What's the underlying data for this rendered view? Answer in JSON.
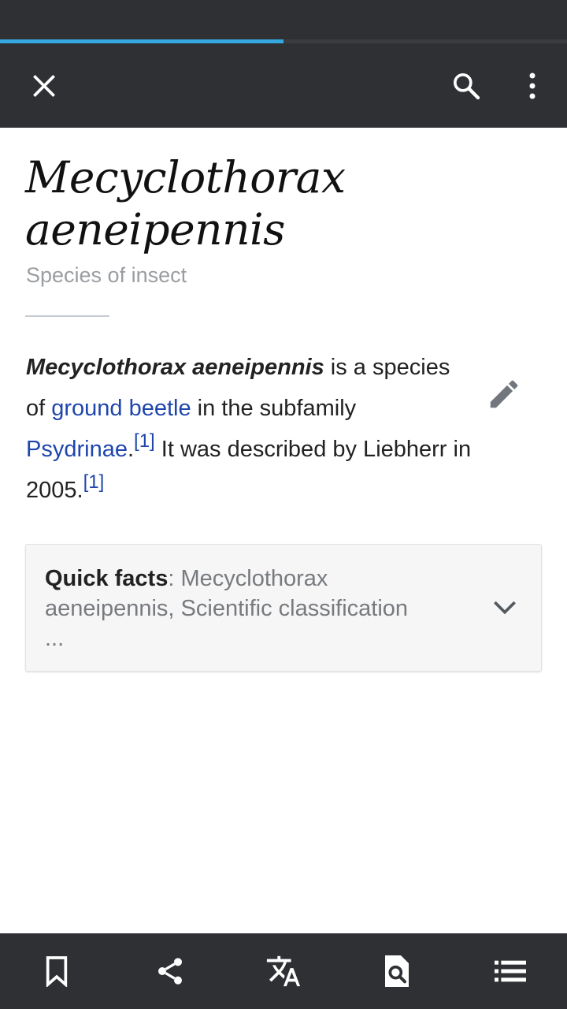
{
  "app": {
    "load_progress": 0.5,
    "accent_color": "#36a8e0",
    "toolbar_bg": "#2e3033",
    "link_color": "#1f46ad"
  },
  "toolbar": {
    "icons": [
      "close-icon",
      "search-icon",
      "more-vert-icon"
    ]
  },
  "article": {
    "title_line1": "Mecyclothorax",
    "title_line2": "aeneipennis",
    "description": "Species of insect",
    "paragraph": {
      "bold_name": "Mecyclothorax aeneipennis",
      "text1": " is a species",
      "text2": "of ",
      "link1": "ground beetle",
      "text3": " in the subfamily",
      "link2": "Psydrinae",
      "period1": ".",
      "ref1": "[1]",
      "text4": " It was described by Liebherr in",
      "text5": "2005.",
      "ref2": "[1]"
    },
    "quick_facts": {
      "label": "Quick facts",
      "sep": ": ",
      "line1": "Mecyclothorax",
      "line2": "aeneipennis, Scientific classification",
      "line3": "..."
    }
  },
  "bottom_bar": {
    "icons": [
      "bookmark-icon",
      "share-icon",
      "translate-icon",
      "find-in-page-icon",
      "contents-icon"
    ]
  }
}
